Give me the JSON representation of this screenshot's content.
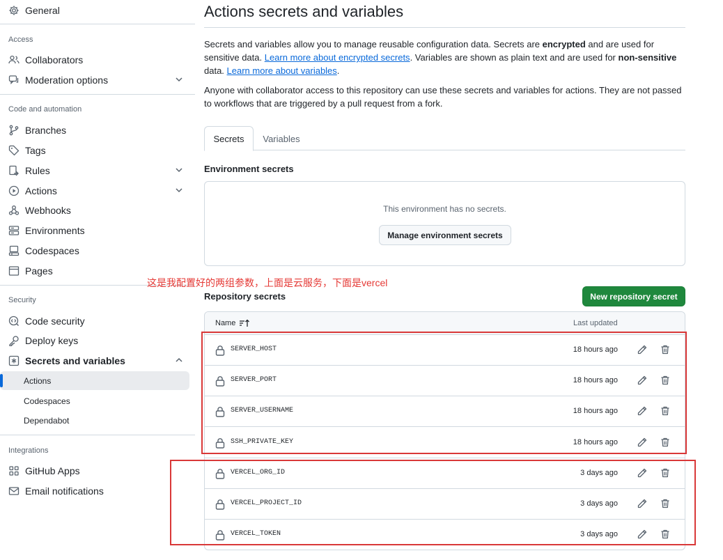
{
  "sidebar": {
    "general": "General",
    "sections": {
      "access": "Access",
      "code_automation": "Code and automation",
      "security": "Security",
      "integrations": "Integrations"
    },
    "items": {
      "collaborators": "Collaborators",
      "moderation": "Moderation options",
      "branches": "Branches",
      "tags": "Tags",
      "rules": "Rules",
      "actions": "Actions",
      "webhooks": "Webhooks",
      "environments": "Environments",
      "codespaces": "Codespaces",
      "pages": "Pages",
      "code_security": "Code security",
      "deploy_keys": "Deploy keys",
      "secrets_variables": "Secrets and variables",
      "sub_actions": "Actions",
      "sub_codespaces": "Codespaces",
      "sub_dependabot": "Dependabot",
      "github_apps": "GitHub Apps",
      "email_notifications": "Email notifications"
    }
  },
  "main": {
    "title": "Actions secrets and variables",
    "desc1": {
      "p1": "Secrets and variables allow you to manage reusable configuration data. Secrets are ",
      "b1": "encrypted",
      "p2": " and are used for sensitive data. ",
      "link1": "Learn more about encrypted secrets",
      "p3": ". Variables are shown as plain text and are used for ",
      "b2": "non-sensitive",
      "p4": " data. ",
      "link2": "Learn more about variables",
      "p5": "."
    },
    "desc2": "Anyone with collaborator access to this repository can use these secrets and variables for actions. They are not passed to workflows that are triggered by a pull request from a fork.",
    "tabs": [
      "Secrets",
      "Variables"
    ],
    "env_heading": "Environment secrets",
    "env_empty": "This environment has no secrets.",
    "env_button": "Manage environment secrets",
    "repo_heading": "Repository secrets",
    "new_secret_button": "New repository secret",
    "table": {
      "col_name": "Name",
      "col_updated": "Last updated",
      "rows": [
        {
          "name": "SERVER_HOST",
          "updated": "18 hours ago"
        },
        {
          "name": "SERVER_PORT",
          "updated": "18 hours ago"
        },
        {
          "name": "SERVER_USERNAME",
          "updated": "18 hours ago"
        },
        {
          "name": "SSH_PRIVATE_KEY",
          "updated": "18 hours ago"
        },
        {
          "name": "VERCEL_ORG_ID",
          "updated": "3 days ago"
        },
        {
          "name": "VERCEL_PROJECT_ID",
          "updated": "3 days ago"
        },
        {
          "name": "VERCEL_TOKEN",
          "updated": "3 days ago"
        }
      ]
    }
  },
  "annotation": "这是我配置好的两组参数，上面是云服务，下面是vercel",
  "colors": {
    "accent": "#0969da",
    "primary_button": "#1f883d",
    "annotation": "#e53935",
    "annotation_box": "#d93838"
  }
}
